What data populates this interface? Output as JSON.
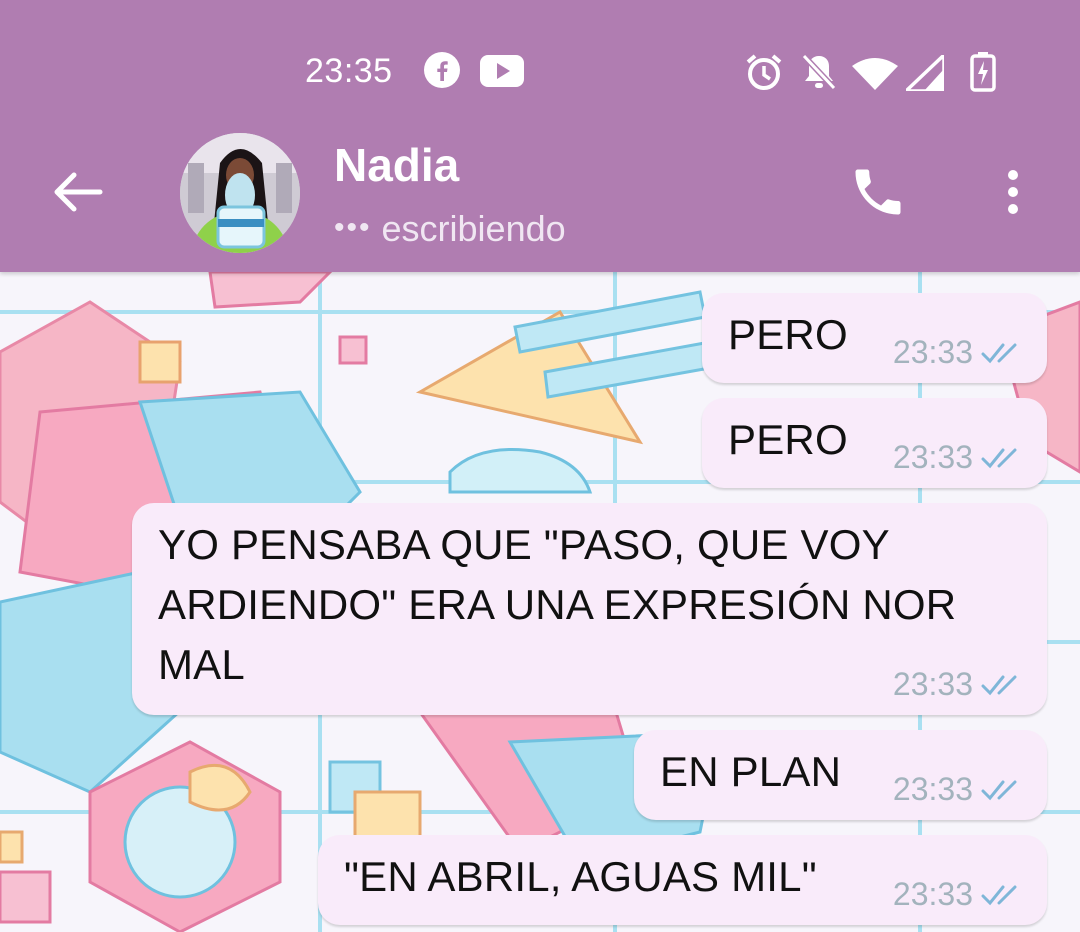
{
  "status_bar": {
    "time": "23:35",
    "icons": [
      "facebook-icon",
      "youtube-icon",
      "alarm-icon",
      "bell-off-icon",
      "wifi-icon",
      "signal-icon",
      "battery-charging-icon"
    ]
  },
  "header": {
    "contact_name": "Nadia",
    "status_text": "escribiendo",
    "typing_dots": "•••",
    "icons": [
      "back-arrow-icon",
      "phone-icon",
      "more-vert-icon"
    ]
  },
  "messages": [
    {
      "text": "PERO",
      "time": "23:33",
      "status": "read"
    },
    {
      "text": "PERO",
      "time": "23:33",
      "status": "read"
    },
    {
      "lines": [
        "YO PENSABA QUE \"PASO, QUE VOY",
        "ARDIENDO\" ERA UNA EXPRESIÓN NOR",
        "MAL"
      ],
      "time": "23:33",
      "status": "read"
    },
    {
      "text": "EN PLAN",
      "time": "23:33",
      "status": "read"
    },
    {
      "text": "\"EN ABRIL, AGUAS MIL\"",
      "time": "23:33",
      "status": "read"
    }
  ],
  "colors": {
    "header": "#b07db1",
    "outgoing_bubble": "#f9ebfa",
    "read_ticks": "#7fb6d8",
    "time_text": "#a3b3bd"
  }
}
